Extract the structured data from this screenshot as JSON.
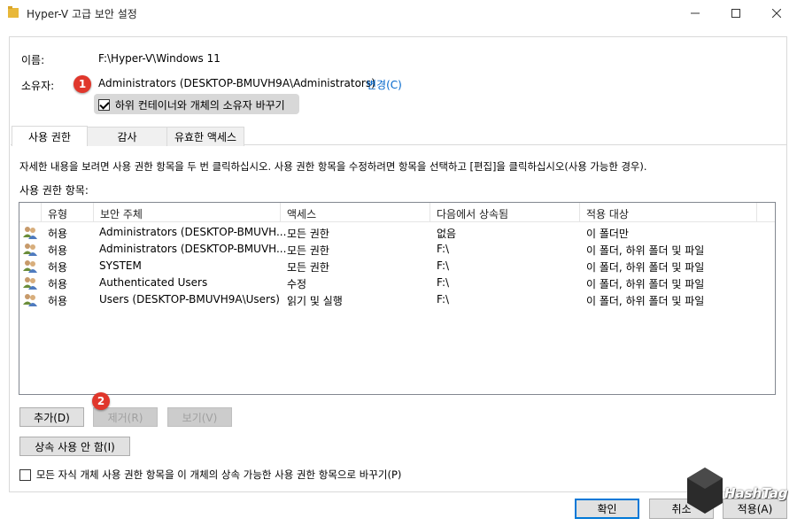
{
  "window": {
    "title": "Hyper-V 고급 보안 설정"
  },
  "owner_section": {
    "name_label": "이름:",
    "name_value": "F:\\Hyper-V\\Windows 11",
    "owner_label": "소유자:",
    "owner_value": "Administrators (DESKTOP-BMUVH9A\\Administrators)",
    "change_link": "변경(C)",
    "replace_owner_checkbox": "하위 컨테이너와 개체의 소유자 바꾸기",
    "replace_owner_checked": true
  },
  "badges": {
    "one": "1",
    "two": "2"
  },
  "tabs": [
    "사용 권한",
    "감사",
    "유효한 액세스"
  ],
  "instructions": "자세한 내용을 보려면 사용 권한 항목을 두 번 클릭하십시오. 사용 권한 항목을 수정하려면 항목을 선택하고 [편집]을 클릭하십시오(사용 가능한 경우).",
  "entries_label": "사용 권한 항목:",
  "table": {
    "columns": [
      "유형",
      "보안 주체",
      "액세스",
      "다음에서 상속됨",
      "적용 대상"
    ],
    "rows": [
      [
        "허용",
        "Administrators (DESKTOP-BMUVH...",
        "모든 권한",
        "없음",
        "이 폴더만"
      ],
      [
        "허용",
        "Administrators (DESKTOP-BMUVH...",
        "모든 권한",
        "F:\\",
        "이 폴더, 하위 폴더 및 파일"
      ],
      [
        "허용",
        "SYSTEM",
        "모든 권한",
        "F:\\",
        "이 폴더, 하위 폴더 및 파일"
      ],
      [
        "허용",
        "Authenticated Users",
        "수정",
        "F:\\",
        "이 폴더, 하위 폴더 및 파일"
      ],
      [
        "허용",
        "Users (DESKTOP-BMUVH9A\\Users)",
        "읽기 및 실행",
        "F:\\",
        "이 폴더, 하위 폴더 및 파일"
      ]
    ]
  },
  "buttons": {
    "add": "추가(D)",
    "remove": "제거(R)",
    "view": "보기(V)",
    "disable_inheritance": "상속 사용 안 함(I)",
    "ok": "확인",
    "cancel": "취소",
    "apply": "적용(A)"
  },
  "replace_child_checkbox": "모든 자식 개체 사용 권한 항목을 이 개체의 상속 가능한 사용 권한 항목으로 바꾸기(P)",
  "replace_child_checked": false,
  "watermark": "HashTag",
  "colors": {
    "accent": "#0078d7",
    "link": "#0066cc",
    "badge": "#e0372c"
  }
}
